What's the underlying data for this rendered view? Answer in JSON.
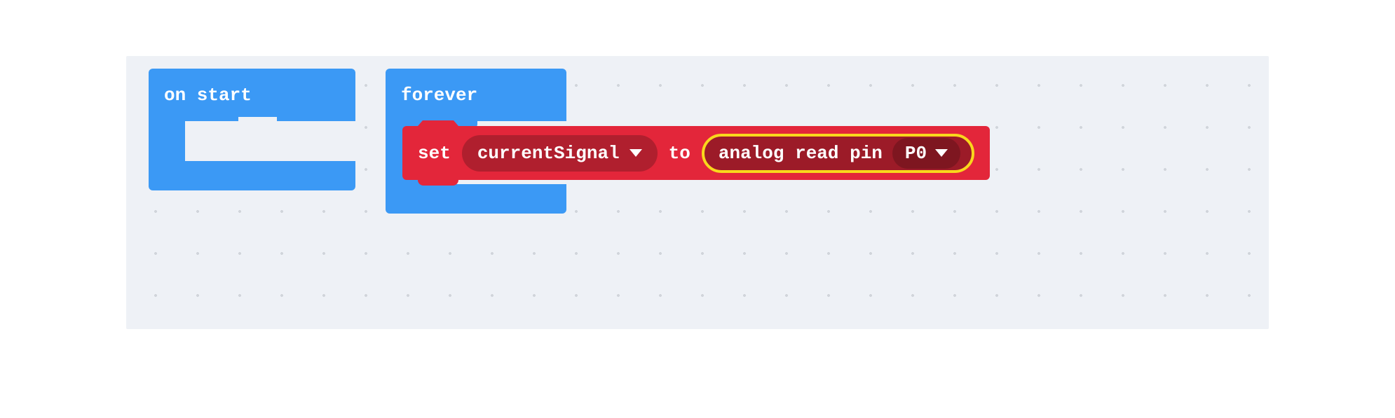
{
  "workspace": {
    "onstart": {
      "label": "on start"
    },
    "forever": {
      "label": "forever"
    },
    "set_block": {
      "keyword_set": "set",
      "variable_name": "currentSignal",
      "keyword_to": "to",
      "reporter": {
        "label": "analog read pin",
        "pin_value": "P0"
      }
    }
  },
  "colors": {
    "event_block": "#3b99f5",
    "variable_block": "#e3263a",
    "variable_pill": "#b01f2e",
    "reporter_pill": "#9c1b28",
    "pin_pill": "#7e1620",
    "highlight": "#f9d71c",
    "workspace_bg": "#eef1f6"
  }
}
